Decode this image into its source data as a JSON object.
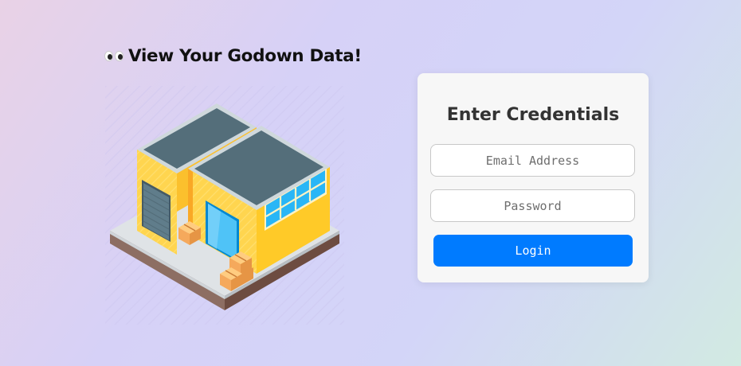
{
  "heading": {
    "emoji_icon": "eyes-icon",
    "text": "View Your Godown Data!"
  },
  "illustration": {
    "icon": "warehouse-illustration"
  },
  "login_card": {
    "title": "Enter Credentials",
    "email": {
      "value": "",
      "placeholder": "Email Address"
    },
    "password": {
      "value": "",
      "placeholder": "Password"
    },
    "login_button_label": "Login"
  },
  "colors": {
    "accent": "#007bff",
    "card_background": "#f7f7f7",
    "warehouse_wall": "#ffd54f",
    "warehouse_roof": "#546e7a"
  }
}
